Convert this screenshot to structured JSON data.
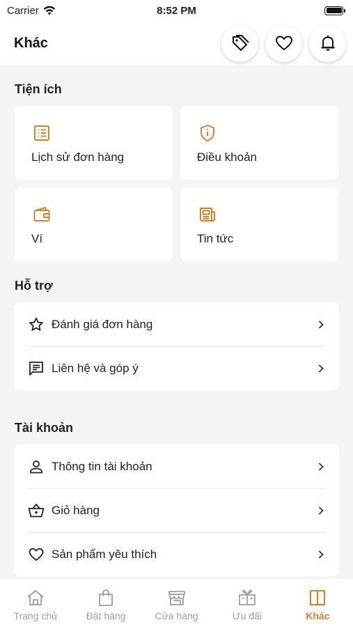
{
  "status_bar": {
    "carrier": "Carrier",
    "time": "8:52 PM"
  },
  "header": {
    "title": "Khác"
  },
  "sections": {
    "utilities": {
      "title": "Tiện ích",
      "tiles": [
        {
          "label": "Lịch sử đơn hàng",
          "icon": "receipt-list-icon"
        },
        {
          "label": "Điều khoản",
          "icon": "shield-info-icon"
        },
        {
          "label": "Ví",
          "icon": "wallet-icon"
        },
        {
          "label": "Tin tức",
          "icon": "newspaper-icon"
        }
      ]
    },
    "support": {
      "title": "Hỗ trợ",
      "rows": [
        {
          "label": "Đánh giá đơn hàng",
          "icon": "star-icon"
        },
        {
          "label": "Liên hệ và góp ý",
          "icon": "chat-icon"
        }
      ]
    },
    "account": {
      "title": "Tài khoản",
      "rows": [
        {
          "label": "Thông tin tài khoản",
          "icon": "person-icon"
        },
        {
          "label": "Giỏ hàng",
          "icon": "basket-icon"
        },
        {
          "label": "Sản phẩm yêu thích",
          "icon": "heart-icon"
        }
      ]
    }
  },
  "tabbar": {
    "tabs": [
      {
        "label": "Trang chủ",
        "icon": "home-icon"
      },
      {
        "label": "Đặt hàng",
        "icon": "shopping-bag-icon"
      },
      {
        "label": "Cửa hàng",
        "icon": "store-icon"
      },
      {
        "label": "Ưu đãi",
        "icon": "gift-voucher-icon"
      },
      {
        "label": "Khác",
        "icon": "book-open-icon",
        "active": true
      }
    ]
  },
  "colors": {
    "accent": "#d9822b",
    "inactive": "#9e9e9e",
    "background": "#f4f4f4"
  }
}
